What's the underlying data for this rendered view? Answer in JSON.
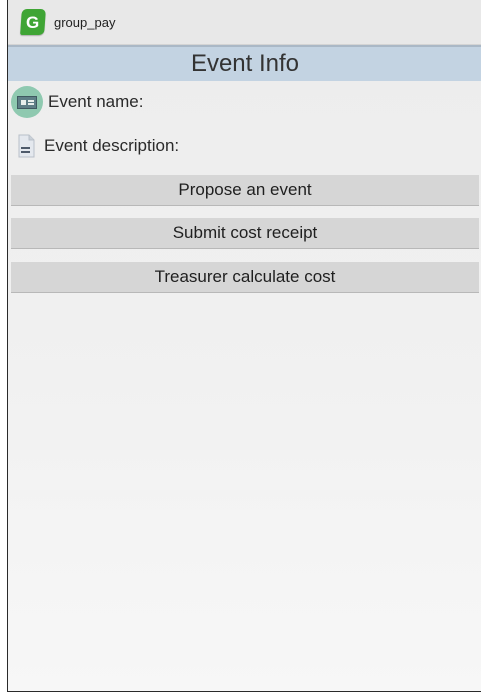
{
  "app": {
    "icon_letter": "G",
    "icon_color": "#3fa535",
    "title": "group_pay"
  },
  "header": {
    "title": "Event Info",
    "band_color": "#c3d3e2"
  },
  "fields": {
    "event_name_label": "Event name:",
    "event_name_icon": "id-card-icon",
    "event_description_label": "Event description:",
    "event_description_icon": "document-icon"
  },
  "buttons": {
    "propose_label": "Propose an event",
    "submit_label": "Submit cost receipt",
    "treasurer_label": "Treasurer calculate cost"
  }
}
